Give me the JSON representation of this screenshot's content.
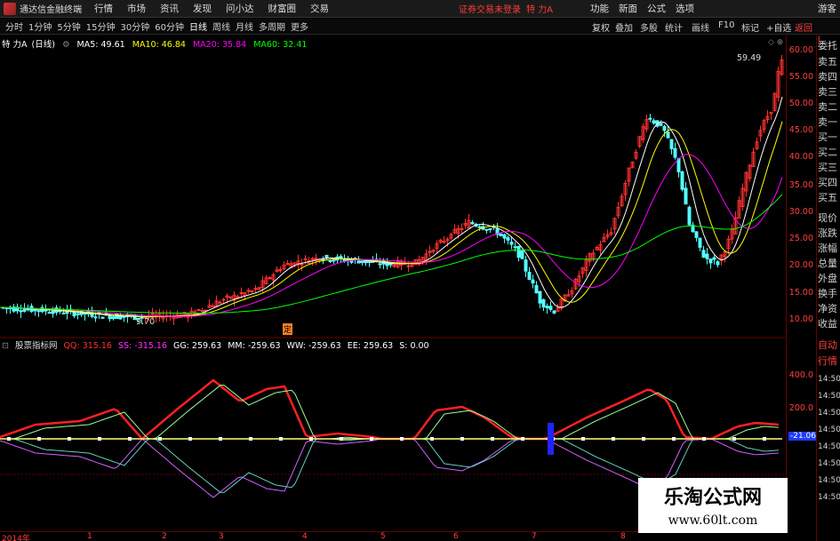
{
  "app": {
    "title": "通达信金融终端"
  },
  "menu": {
    "items": [
      "行情",
      "市场",
      "资讯",
      "发现",
      "问小达",
      "财富圈",
      "交易"
    ],
    "status": "证券交易未登录",
    "stock": "特 力A",
    "right_items": [
      "功能",
      "新面",
      "公式",
      "选项",
      "游客"
    ]
  },
  "toolbar": {
    "periods": [
      "分时",
      "1分钟",
      "5分钟",
      "15分钟",
      "30分钟",
      "60分钟",
      "日线",
      "周线",
      "月线",
      "多周期",
      "更多"
    ],
    "right_items": [
      "复权",
      "叠加",
      "多股",
      "统计",
      "画线",
      "F10",
      "标记",
      "+自选",
      "返回"
    ]
  },
  "chart": {
    "stock_label": "特 力A",
    "period_label": "(日线)",
    "ma": [
      {
        "label": "MA5: 49.61",
        "color": "#ffffff"
      },
      {
        "label": "MA10: 46.84",
        "color": "#ffff00"
      },
      {
        "label": "MA20: 35.84",
        "color": "#ff00ff"
      },
      {
        "label": "MA60: 32.41",
        "color": "#00ff00"
      }
    ],
    "hi_label": "59.49",
    "lo_label": "9.70",
    "marker": "定",
    "price_ticks": [
      "60.00",
      "55.00",
      "50.00",
      "45.00",
      "40.00",
      "35.00",
      "30.00",
      "25.00",
      "20.00",
      "15.00",
      "10.00"
    ]
  },
  "indicator": {
    "name": "股票指标网",
    "values": [
      {
        "label": "QQ: 315.16",
        "color": "#ff3030"
      },
      {
        "label": "SS: -315.16",
        "color": "#ff30ff"
      },
      {
        "label": "GG: 259.63",
        "color": "#ffffff"
      },
      {
        "label": "MM: -259.63",
        "color": "#ffffff"
      },
      {
        "label": "WW: -259.63",
        "color": "#ffffff"
      },
      {
        "label": "EE: 259.63",
        "color": "#ffffff"
      },
      {
        "label": "S: 0.00",
        "color": "#ffffff"
      }
    ],
    "ticks": [
      "400.0",
      "200.0"
    ],
    "current": "-21.06"
  },
  "sidebar": {
    "items": [
      "委托",
      "卖五",
      "卖四",
      "卖三",
      "卖二",
      "卖一",
      "买一",
      "买二",
      "买三",
      "买四",
      "买五",
      "现价",
      "涨跌",
      "涨幅",
      "总量",
      "外盘",
      "换手",
      "净资",
      "收益",
      "自动",
      "行情"
    ],
    "times": [
      "14:50",
      "14:50",
      "14:50",
      "14:50",
      "14:50",
      "14:50",
      "14:50",
      "14:50"
    ]
  },
  "time_axis": [
    "2014年",
    "1",
    "2",
    "3",
    "4",
    "5",
    "6",
    "7",
    "8"
  ],
  "watermark": {
    "line1": "乐淘公式网",
    "line2": "www.60lt.com"
  }
}
